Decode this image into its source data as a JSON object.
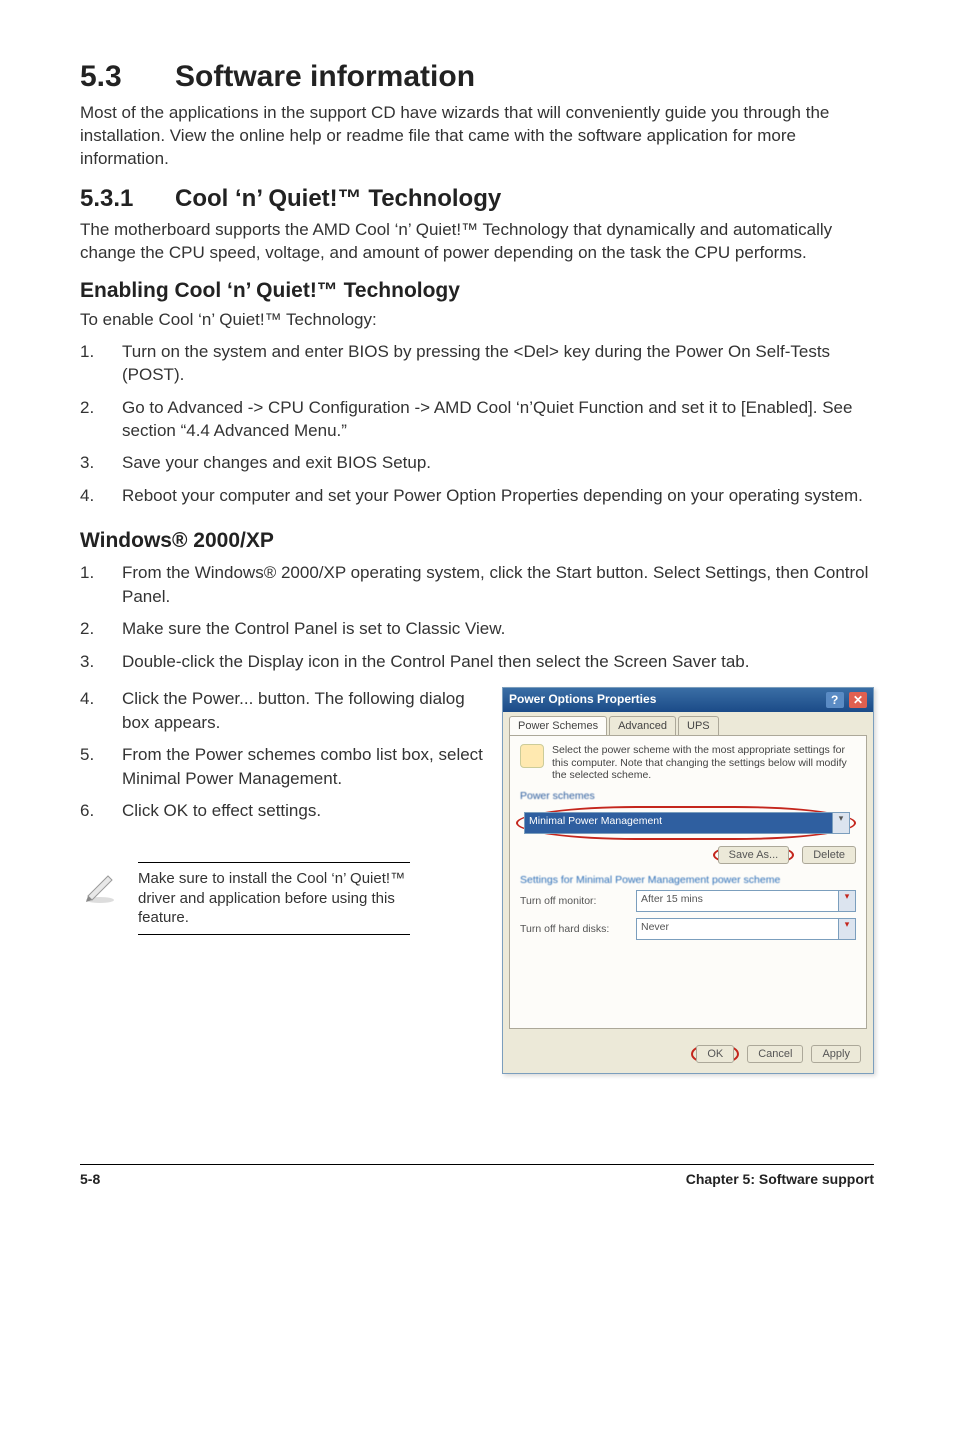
{
  "section": {
    "number": "5.3",
    "title": "Software information",
    "intro": "Most of the applications in the support CD have wizards that will conveniently guide you through the installation. View the online help or readme file that came with the software application for more information."
  },
  "sub": {
    "number": "5.3.1",
    "title": "Cool ‘n’ Quiet!™ Technology",
    "intro": "The motherboard supports the AMD Cool ‘n’ Quiet!™ Technology that dynamically and automatically change the CPU speed, voltage, and amount of power depending on the task the CPU performs."
  },
  "enable": {
    "heading": "Enabling Cool ‘n’ Quiet!™ Technology",
    "lead": "To enable Cool ‘n’ Quiet!™ Technology:",
    "steps": [
      "Turn on the system and enter BIOS by pressing the <Del> key during the Power On Self-Tests (POST).",
      "Go to Advanced -> CPU Configuration -> AMD Cool ‘n’Quiet Function and set it to [Enabled]. See section “4.4 Advanced Menu.”",
      "Save your changes and exit  BIOS Setup.",
      "Reboot your computer and set your Power Option Properties depending on your operating system."
    ]
  },
  "winxp": {
    "heading": "Windows® 2000/XP",
    "steps_top": [
      "From the Windows® 2000/XP operating system, click the Start button. Select Settings, then Control Panel.",
      "Make sure the Control Panel is set to Classic View.",
      "Double-click the Display icon in the Control Panel then select the Screen Saver tab."
    ],
    "steps_left": [
      "Click the Power... button. The following dialog box appears.",
      "From the Power schemes combo list box, select Minimal Power Management.",
      "Click OK to effect settings."
    ]
  },
  "note": "Make sure to install the Cool ‘n’ Quiet!™ driver and application before using this feature.",
  "dialog": {
    "title": "Power Options Properties",
    "tabs": [
      "Power Schemes",
      "Advanced",
      "UPS"
    ],
    "info": "Select the power scheme with the most appropriate settings for this computer. Note that changing the settings below will modify the selected scheme.",
    "group1": "Power schemes",
    "scheme": "Minimal Power Management",
    "save_as": "Save As...",
    "delete": "Delete",
    "group2": "Settings for Minimal Power Management power scheme",
    "monitor_label": "Turn off monitor:",
    "monitor_value": "After 15 mins",
    "hdd_label": "Turn off hard disks:",
    "hdd_value": "Never",
    "ok": "OK",
    "cancel": "Cancel",
    "apply": "Apply"
  },
  "footer": {
    "left": "5-8",
    "right": "Chapter 5: Software support"
  }
}
